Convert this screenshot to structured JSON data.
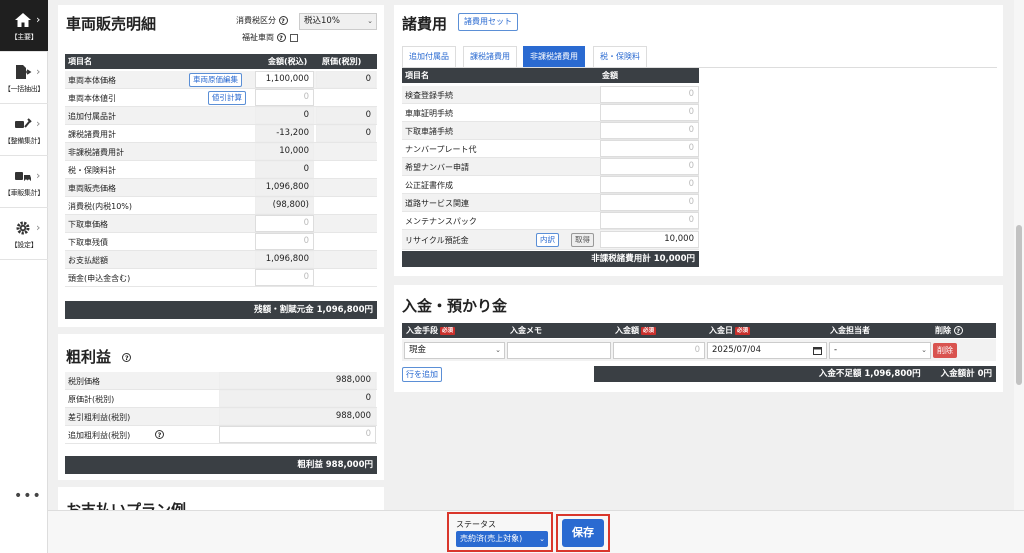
{
  "sidebar": {
    "items": [
      {
        "label": "【主要】",
        "icon": "home-icon"
      },
      {
        "label": "【一括抽出】",
        "icon": "file-export-icon"
      },
      {
        "label": "【整備集計】",
        "icon": "wrench-car-icon"
      },
      {
        "label": "【車販集計】",
        "icon": "car-icon"
      },
      {
        "label": "【設定】",
        "icon": "gear-icon"
      }
    ],
    "more": "•••"
  },
  "sales": {
    "title": "車両販売明細",
    "tax_label": "消費税区分",
    "tax_value": "税込10%",
    "welfare_label": "福祉車両",
    "col_item": "項目名",
    "col_amount": "金額(税込)",
    "col_cost": "原価(税別)",
    "rows": [
      {
        "label": "車両本体価格",
        "btn": "車両原価編集",
        "amount": "1,100,000",
        "cost": "0"
      },
      {
        "label": "車両本体値引",
        "btn": "値引計算",
        "amount": "0",
        "cost": ""
      },
      {
        "label": "追加付属品計",
        "amount": "0",
        "cost": "0"
      },
      {
        "label": "課税諸費用計",
        "amount": "-13,200",
        "cost": "0"
      },
      {
        "label": "非課税諸費用計",
        "amount": "10,000",
        "cost": ""
      },
      {
        "label": "税・保険料計",
        "amount": "0",
        "cost": ""
      },
      {
        "label": "車両販売価格",
        "amount": "1,096,800",
        "cost": ""
      },
      {
        "label": "消費税(内税10%)",
        "amount": "(98,800)",
        "cost": ""
      },
      {
        "label": "下取車価格",
        "amount": "0",
        "cost": ""
      },
      {
        "label": "下取車残債",
        "amount": "0",
        "cost": ""
      },
      {
        "label": "お支払総額",
        "amount": "1,096,800",
        "cost": ""
      },
      {
        "label": "頭金(申込金含む)",
        "amount": "0",
        "cost": ""
      }
    ],
    "footer": "残額・割賦元金 1,096,800円"
  },
  "profit": {
    "title": "粗利益",
    "rows": [
      {
        "label": "税別価格",
        "value": "988,000"
      },
      {
        "label": "原価計(税別)",
        "value": "0"
      },
      {
        "label": "差引粗利益(税別)",
        "value": "988,000"
      },
      {
        "label": "追加粗利益(税別)",
        "value": "0"
      }
    ],
    "footer": "粗利益 988,000円"
  },
  "next_title": "お支払いプラン例",
  "fees": {
    "title": "諸費用",
    "set_btn": "諸費用セット",
    "tabs": [
      "追加付属品",
      "課税諸費用",
      "非課税諸費用",
      "税・保険料"
    ],
    "col_item": "項目名",
    "col_amount": "金額",
    "rows": [
      {
        "label": "検査登録手続",
        "value": "0"
      },
      {
        "label": "車庫証明手続",
        "value": "0"
      },
      {
        "label": "下取車諸手続",
        "value": "0"
      },
      {
        "label": "ナンバープレート代",
        "value": "0"
      },
      {
        "label": "希望ナンバー申請",
        "value": "0"
      },
      {
        "label": "公正証書作成",
        "value": "0"
      },
      {
        "label": "道路サービス関連",
        "value": "0"
      },
      {
        "label": "メンテナンスパック",
        "value": "0"
      },
      {
        "label": "リサイクル預託金",
        "value": "10,000"
      }
    ],
    "btn_detail": "内訳",
    "btn_get": "取得",
    "footer": "非課税諸費用計 10,000円"
  },
  "payment": {
    "title": "入金・預かり金",
    "cols": [
      "入金手段",
      "入金メモ",
      "入金額",
      "入金日",
      "入金担当者",
      "削除"
    ],
    "req": "必須",
    "method": "現金",
    "amount_ph": "0",
    "date": "2025/07/04",
    "staff": "-",
    "delete_btn": "削除",
    "add_btn": "行を追加",
    "shortage": "入金不足額 1,096,800円",
    "total": "入金額計 0円"
  },
  "bottom": {
    "status_label": "ステータス",
    "status_value": "売約済(売上対象)",
    "save_btn": "保存"
  },
  "colors": {
    "accent": "#2a6ad1",
    "highlight": "#d9362b",
    "dark": "#3a3f44"
  }
}
